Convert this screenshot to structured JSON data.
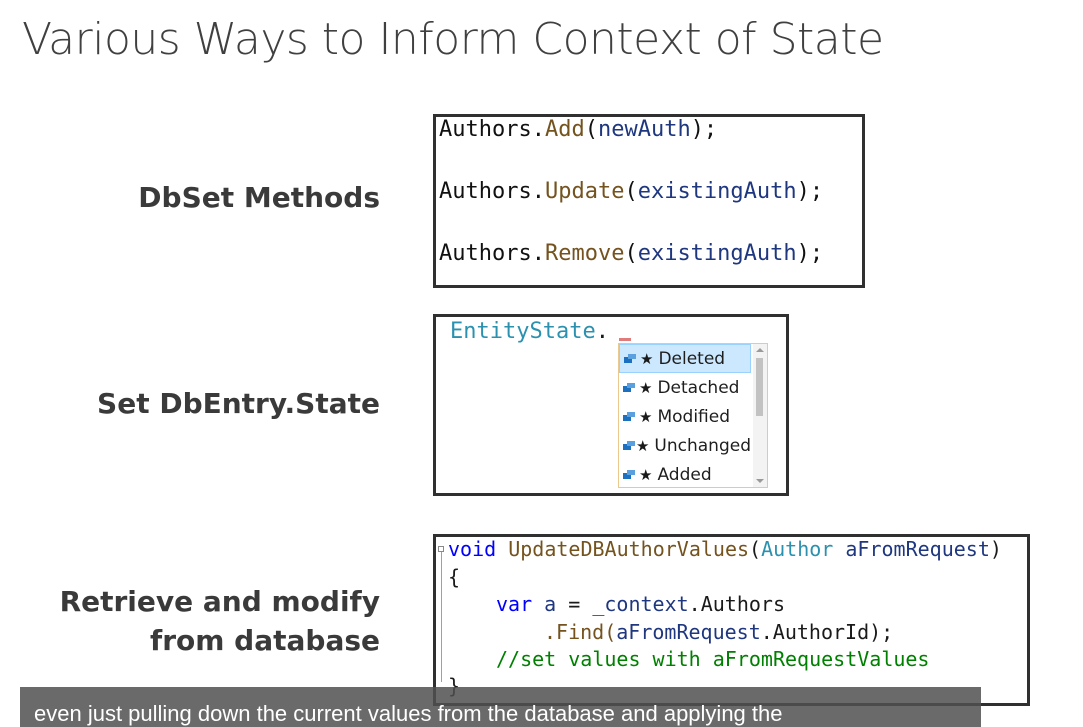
{
  "slide": {
    "title": "Various Ways to Inform Context of State"
  },
  "sections": {
    "dbset": {
      "label": "DbSet Methods",
      "code": {
        "line1": {
          "obj": "Authors",
          "dot": ".",
          "method": "Add",
          "open": "(",
          "arg": "newAuth",
          "close": ");"
        },
        "line2": {
          "obj": "Authors",
          "dot": ".",
          "method": "Update",
          "open": "(",
          "arg": "existingAuth",
          "close": ");"
        },
        "line3": {
          "obj": "Authors",
          "dot": ".",
          "method": "Remove",
          "open": "(",
          "arg": "existingAuth",
          "close": ");"
        }
      }
    },
    "state": {
      "label": "Set DbEntry.State",
      "prefix": "EntityState",
      "dot": ".",
      "options": [
        "Deleted",
        "Detached",
        "Modified",
        "Unchanged",
        "Added"
      ],
      "selected": "Deleted",
      "star": "★"
    },
    "retrieve": {
      "label_line1": "Retrieve and modify",
      "label_line2": "from database",
      "code": {
        "kw_void": "void",
        "method_name": "UpdateDBAuthorValues",
        "paren_open": "(",
        "param_type": "Author",
        "param_name": "aFromRequest",
        "paren_close": ")",
        "brace_open": "{",
        "kw_var": "var",
        "var_name": "a",
        "assign": " = ",
        "context": "_context",
        "authors_prop": ".Authors",
        "find_call": ".Find(",
        "find_arg": "aFromRequest",
        "find_rest": ".AuthorId);",
        "comment": "//set values with aFromRequestValues",
        "brace_close": "}"
      }
    }
  },
  "caption": {
    "text": "even just pulling down the current values from the database and applying the"
  }
}
